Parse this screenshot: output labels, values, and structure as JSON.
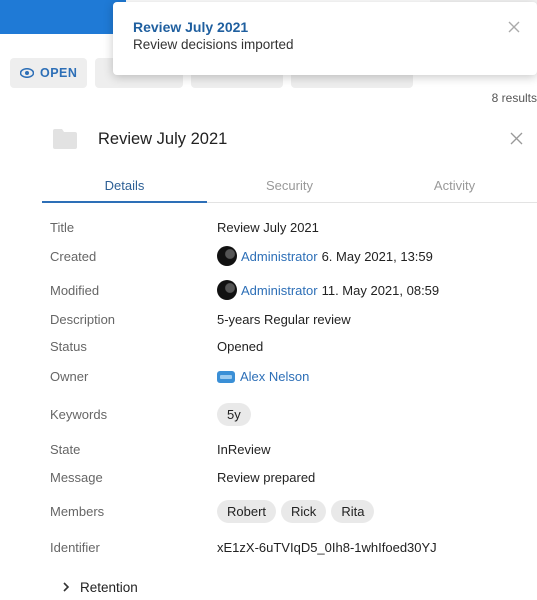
{
  "toolbar": {
    "open_label": "OPEN"
  },
  "results_label": "8 results",
  "toast": {
    "title": "Review July 2021",
    "message": "Review decisions imported"
  },
  "panel": {
    "title": "Review July 2021"
  },
  "tabs": [
    {
      "label": "Details",
      "active": true
    },
    {
      "label": "Security",
      "active": false
    },
    {
      "label": "Activity",
      "active": false
    }
  ],
  "details": {
    "title": {
      "label": "Title",
      "value": "Review July 2021"
    },
    "created": {
      "label": "Created",
      "user": "Administrator",
      "date": "6. May 2021, 13:59"
    },
    "modified": {
      "label": "Modified",
      "user": "Administrator",
      "date": "11. May 2021, 08:59"
    },
    "description": {
      "label": "Description",
      "value": "5-years Regular review"
    },
    "status": {
      "label": "Status",
      "value": "Opened"
    },
    "owner": {
      "label": "Owner",
      "value": "Alex Nelson"
    },
    "keywords": {
      "label": "Keywords",
      "chips": [
        "5y"
      ]
    },
    "state": {
      "label": "State",
      "value": "InReview"
    },
    "message": {
      "label": "Message",
      "value": "Review prepared"
    },
    "members": {
      "label": "Members",
      "chips": [
        "Robert",
        "Rick",
        "Rita"
      ]
    },
    "identifier": {
      "label": "Identifier",
      "value": "xE1zX-6uTVIqD5_0Ih8-1whIfoed30YJ"
    }
  },
  "retention": {
    "label": "Retention"
  },
  "icons": {
    "open": "eye-icon",
    "close": "close-icon",
    "folder": "folder-icon",
    "expand": "chevron-right-icon",
    "owner": "user-card-icon",
    "avatar": "avatar"
  },
  "colors": {
    "accent": "#2d6fb7",
    "appbar": "#1f7ad6",
    "toast_title": "#1f5f9f"
  }
}
